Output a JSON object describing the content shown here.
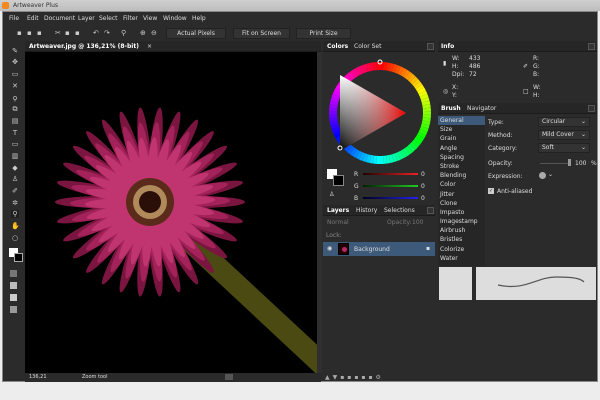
{
  "window": {
    "title": "Artweaver Plus"
  },
  "menu": [
    "File",
    "Edit",
    "Document",
    "Layer",
    "Select",
    "Filter",
    "View",
    "Window",
    "Help"
  ],
  "toolbar": {
    "actual_pixels": "Actual Pixels",
    "fit_on_screen": "Fit on Screen",
    "print_size": "Print Size"
  },
  "document": {
    "tab": "Artweaver.jpg @ 136,21% (8-bit)",
    "close": "×"
  },
  "status": {
    "zoom": "136,21",
    "tool": "Zoom tool"
  },
  "colors": {
    "tabs": [
      "Colors",
      "Color Set"
    ],
    "r_label": "R",
    "g_label": "G",
    "b_label": "B",
    "r": "0",
    "g": "0",
    "b": "0"
  },
  "layers": {
    "tabs": [
      "Layers",
      "History",
      "Selections"
    ],
    "mode": "Normal",
    "opacity_label": "Opacity:",
    "opacity": "100",
    "lock_label": "Lock:",
    "layer_name": "Background"
  },
  "info": {
    "title": "Info",
    "w_label": "W:",
    "w": "433",
    "h_label": "H:",
    "h": "486",
    "dpi_label": "Dpi:",
    "dpi": "72",
    "r": "R:",
    "g": "G:",
    "b": "B:",
    "x": "X:",
    "y": "Y:",
    "w2": "W:",
    "h2": "H:"
  },
  "brush": {
    "tabs": [
      "Brush",
      "Navigator"
    ],
    "categories": [
      "General",
      "Size",
      "Grain",
      "Angle",
      "Spacing",
      "Stroke",
      "Blending",
      "Color",
      "Jitter",
      "Clone",
      "Impasto",
      "Imagestamp",
      "Airbrush",
      "Bristles",
      "Colorize",
      "Water"
    ],
    "type_label": "Type:",
    "type": "Circular",
    "method_label": "Method:",
    "method": "Mild Cover",
    "category_label": "Category:",
    "category": "Soft",
    "opacity_label": "Opacity:",
    "opacity": "100",
    "opacity_unit": "%",
    "expression_label": "Expression:",
    "antialiased": "Anti-aliased"
  },
  "colors_hex": {
    "accent": "#3d5a7a",
    "petal": "#b52a66"
  }
}
